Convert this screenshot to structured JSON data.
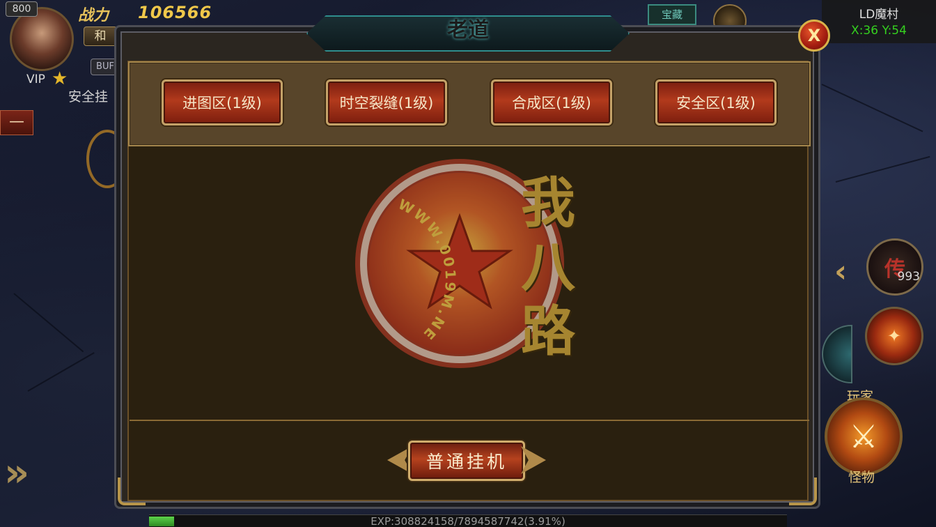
{
  "hud": {
    "level": "800",
    "power_label": "战力",
    "power_value": "106566",
    "pk_mode": "和",
    "buff_label": "BUF",
    "vip_label": "VIP",
    "vip_star": "★",
    "auto_status": "安全挂",
    "collapse_button": "—",
    "expand_arrow": "»",
    "top_tag": "宝藏"
  },
  "map": {
    "name": "LD魔村",
    "coords": "X:36 Y:54"
  },
  "right_panel": {
    "expand_arrow": "‹",
    "legend_glyph": "传",
    "legend_count": "993",
    "fire_glyph": "✦",
    "pvp_label_top": "玩家",
    "pvp_label_bottom": "怪物",
    "pvp_glyph": "⚔"
  },
  "exp": {
    "text": "EXP:308824158/7894587742(3.91%)",
    "percent": 3.91
  },
  "dialog": {
    "title": "老道",
    "close_label": "X",
    "zones": [
      {
        "label": "进图区(1级)"
      },
      {
        "label": "时空裂缝(1级)"
      },
      {
        "label": "合成区(1级)"
      },
      {
        "label": "安全区(1级)"
      }
    ],
    "action_label": "普通挂机"
  },
  "watermark": {
    "ring_text": "WWW.0019M.NET",
    "chars": [
      "我",
      "八",
      "路"
    ]
  },
  "colors": {
    "accent_gold": "#c4a268",
    "button_red": "#b23a1c",
    "coords_green": "#35d11f",
    "title_teal": "#2f8d8d"
  }
}
